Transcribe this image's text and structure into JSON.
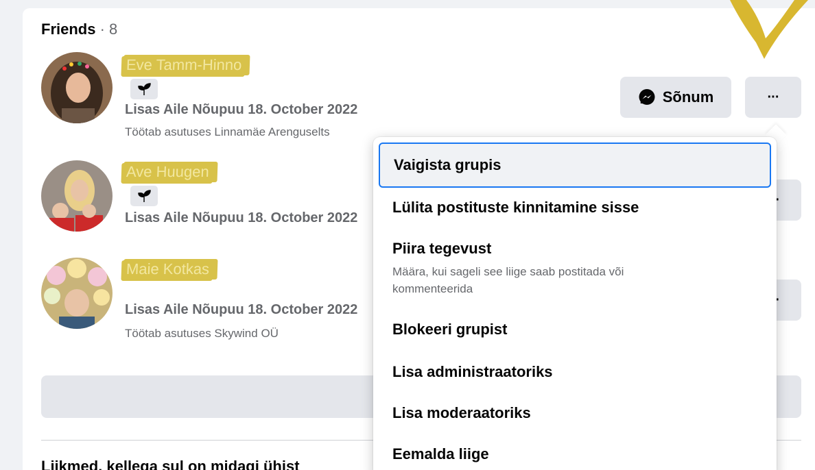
{
  "friends": {
    "title": "Friends",
    "separator": " · ",
    "count": "8"
  },
  "members": [
    {
      "name": "Eve Tamm-Hinno",
      "added": "Lisas Aile Nõupuu 18. October 2022",
      "work": "Töötab asutuses Linnamäe Arenguselts",
      "has_badge": true
    },
    {
      "name": "Ave Huugen",
      "added": "Lisas Aile Nõupuu 18. October 2022",
      "work": "",
      "has_badge": true
    },
    {
      "name": "Maie Kotkas",
      "added": "Lisas Aile Nõupuu 18. October 2022",
      "work": "Töötab asutuses Skywind OÜ",
      "has_badge": false
    }
  ],
  "actions": {
    "message_label": "Sõnum",
    "more_label": "···"
  },
  "menu": {
    "items": [
      {
        "label": "Vaigista grupis",
        "desc": ""
      },
      {
        "label": "Lülita postituste kinnitamine sisse",
        "desc": ""
      },
      {
        "label": "Piira tegevust",
        "desc": "Määra, kui sageli see liige saab postitada või kommenteerida"
      },
      {
        "label": "Blokeeri grupist",
        "desc": ""
      },
      {
        "label": "Lisa administraatoriks",
        "desc": ""
      },
      {
        "label": "Lisa moderaatoriks",
        "desc": ""
      },
      {
        "label": "Eemalda liige",
        "desc": ""
      }
    ]
  },
  "footer": {
    "title": "Liikmed, kellega sul on midagi ühist"
  },
  "colors": {
    "highlighter": "#d8c24a",
    "focus_ring": "#1877f2",
    "button_bg": "#e4e6eb",
    "secondary_text": "#65676b"
  },
  "icons": {
    "badge": "sprout-icon",
    "message": "messenger-icon",
    "annotation": "hand-drawn-arrow-icon"
  }
}
